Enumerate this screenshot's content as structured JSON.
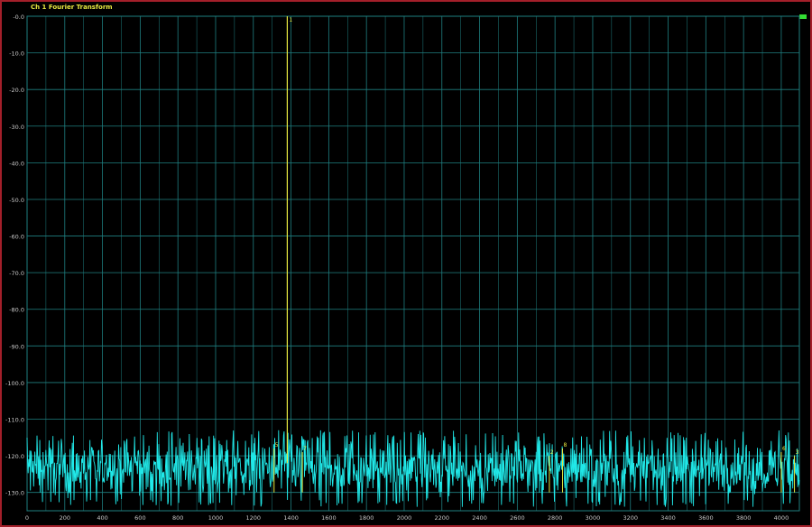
{
  "window": {
    "title": "Ch 1 Fourier Transform",
    "frame_color": "#a31f2a",
    "background": "#000000"
  },
  "colors": {
    "grid": "#1f7f80",
    "trace": "#20e8e8",
    "marker": "#e8e840",
    "axis_text": "#c8c8c8"
  },
  "chart_data": {
    "type": "line",
    "title": "Ch 1 Fourier Transform",
    "xlabel": "",
    "ylabel": "",
    "xlim": [
      0,
      4096
    ],
    "ylim": [
      -135,
      0
    ],
    "grid": true,
    "x_ticks": [
      0,
      200,
      400,
      600,
      800,
      1000,
      1200,
      1400,
      1600,
      1800,
      2000,
      2200,
      2400,
      2600,
      2800,
      3000,
      3200,
      3400,
      3600,
      3800,
      4000
    ],
    "x_tick_labels": [
      "0",
      "200",
      "400",
      "600",
      "800",
      "1000",
      "1200",
      "1400",
      "1600",
      "1800",
      "2000",
      "2200",
      "2400",
      "2600",
      "2800",
      "3000",
      "3200",
      "3400",
      "3600",
      "3800",
      "4000"
    ],
    "y_ticks": [
      0,
      -10,
      -20,
      -30,
      -40,
      -50,
      -60,
      -70,
      -80,
      -90,
      -100,
      -110,
      -120,
      -130
    ],
    "y_tick_labels": [
      "-0.0",
      "-10.0",
      "-20.0",
      "-30.0",
      "-40.0",
      "-50.0",
      "-60.0",
      "-70.0",
      "-80.0",
      "-90.0",
      "-100.0",
      "-110.0",
      "-120.0",
      "-130.0"
    ],
    "noise_floor": {
      "mean": -122,
      "min": -134,
      "max": -113
    },
    "fundamental": {
      "label": "1",
      "x": 1380,
      "y": 0
    },
    "harmonic_markers": [
      {
        "label": "5",
        "x": 1310,
        "y": -118
      },
      {
        "label": "7",
        "x": 1460,
        "y": -119
      },
      {
        "label": "2",
        "x": 2770,
        "y": -120
      },
      {
        "label": "8",
        "x": 2840,
        "y": -118
      },
      {
        "label": "6",
        "x": 4000,
        "y": -119
      },
      {
        "label": "3",
        "x": 4070,
        "y": -120
      }
    ]
  }
}
